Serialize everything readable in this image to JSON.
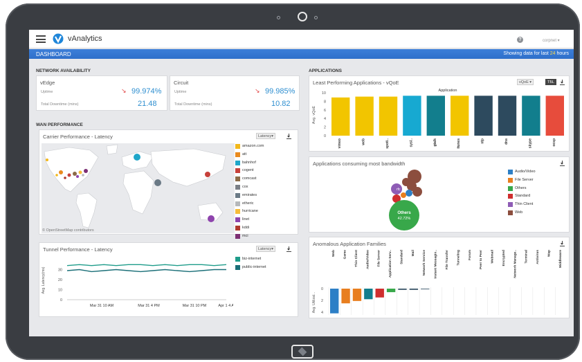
{
  "app": {
    "brand": "vAnalytics",
    "user": "corpnet ▾",
    "help": "?"
  },
  "dashbar": {
    "title": "DASHBOARD",
    "range_prefix": "Showing data for last",
    "range_value": "24",
    "range_unit": "hours"
  },
  "network": {
    "title": "NETWORK AVAILABILITY",
    "vedge": {
      "title": "vEdge",
      "uptime_label": "Uptime",
      "uptime": "99.974%",
      "downtime_label": "Total Downtime (mins)",
      "downtime": "21.48"
    },
    "circuit": {
      "title": "Circuit",
      "uptime_label": "Uptime",
      "uptime": "99.985%",
      "downtime_label": "Total Downtime (mins)",
      "downtime": "10.82"
    }
  },
  "wan": {
    "title": "WAN PERFORMANCE",
    "carrier": {
      "title": "Carrier Performance - Latency",
      "dropdown": "Latency▾",
      "credit": "© OpenStreetMap contributors",
      "legend": [
        {
          "name": "amazon.com",
          "color": "#f2b81b"
        },
        {
          "name": "att",
          "color": "#e98a1e"
        },
        {
          "name": "bahnhof",
          "color": "#1fa6c9"
        },
        {
          "name": "cogent",
          "color": "#c7413b"
        },
        {
          "name": "comcast",
          "color": "#8b6b47"
        },
        {
          "name": "cox",
          "color": "#7a7f86"
        },
        {
          "name": "emirates",
          "color": "#6b7a86"
        },
        {
          "name": "etheric",
          "color": "#b6b8bb"
        },
        {
          "name": "hurricane",
          "color": "#f6bc3a"
        },
        {
          "name": "linet",
          "color": "#8e44ad"
        },
        {
          "name": "kddi",
          "color": "#b03a2e"
        },
        {
          "name": "mci",
          "color": "#7d2f73"
        }
      ]
    },
    "tunnel": {
      "title": "Tunnel Performance - Latency",
      "dropdown": "Latency▾",
      "ylabel": "Avg. Latency(ms)",
      "legend": [
        {
          "name": "biz-internet",
          "color": "#1e9c8a"
        },
        {
          "name": "public-internet",
          "color": "#1b6f78"
        }
      ]
    }
  },
  "apps": {
    "title": "APPLICATIONS",
    "least": {
      "title": "Least Performing Applications - vQoE",
      "dropdown": "vQoE ▾",
      "toggle": "ТБL",
      "legend_title": "Application"
    },
    "bandwidth": {
      "title": "Applications consuming most bandwidth",
      "bubble_label": "Others",
      "bubble_value": "42.72%",
      "bubble_small": "rfc",
      "legend": [
        {
          "name": "Audio/Video",
          "color": "#2d7fc6"
        },
        {
          "name": "File Server",
          "color": "#e87e1f"
        },
        {
          "name": "Others",
          "color": "#38a84a"
        },
        {
          "name": "Standard",
          "color": "#cf2e2e"
        },
        {
          "name": "Thin Client",
          "color": "#8e5cb5"
        },
        {
          "name": "Web",
          "color": "#8c4e3e"
        }
      ]
    },
    "anomalous": {
      "title": "Anomalous Application Families",
      "ylabel": "Avg. Utilizat..."
    }
  },
  "chart_data": [
    {
      "type": "bar",
      "title": "Least Performing Applications - vQoE",
      "xlabel": "",
      "ylabel": "Avg. vQoE",
      "ylim": [
        0,
        10
      ],
      "yticks": [
        0,
        2,
        4,
        6,
        8,
        10
      ],
      "categories": [
        "vimeo",
        "web",
        "spoti..",
        "sysl..",
        "gtalk",
        "itunes",
        "ntp",
        "dns",
        "skype",
        "ocsp"
      ],
      "values": [
        8.9,
        9.1,
        9.1,
        9.3,
        9.3,
        9.3,
        9.3,
        9.3,
        9.3,
        9.3
      ],
      "colors": [
        "#f2c500",
        "#f2c500",
        "#f2c500",
        "#17a9d1",
        "#127e8d",
        "#f2c500",
        "#2d4a5e",
        "#2d4a5e",
        "#127e8d",
        "#e74c3c"
      ]
    },
    {
      "type": "line",
      "title": "Tunnel Performance - Latency",
      "ylabel": "Avg. Latency(ms)",
      "ylim": [
        0,
        40
      ],
      "yticks": [
        0,
        10,
        20,
        30
      ],
      "x": [
        "Mar 31 10 AM",
        "Mar 31 4 PM",
        "Mar 31 10 PM",
        "Apr 1 4 AM"
      ],
      "series": [
        {
          "name": "biz-internet",
          "values": [
            34,
            35,
            34,
            35,
            34,
            35,
            35,
            34,
            35,
            34,
            35,
            35,
            34,
            35
          ]
        },
        {
          "name": "public-internet",
          "values": [
            29,
            30,
            28,
            29,
            30,
            29,
            28,
            29,
            30,
            29,
            28,
            29,
            30,
            30
          ]
        }
      ]
    },
    {
      "type": "bar",
      "title": "Anomalous Application Families",
      "ylabel": "Avg. Utilizat...",
      "ylim": [
        4,
        0
      ],
      "yticks": [
        0,
        2,
        4
      ],
      "categories": [
        "Web",
        "Game",
        "Thin Client",
        "Audio/Video",
        "File Server",
        "Application Serv..",
        "Standard",
        "Mail",
        "Network Service",
        "Instant Messagin..",
        "File Transfer",
        "Tunneling",
        "Forum",
        "Peer to Peer",
        "Webmail",
        "Encrypted",
        "Network Manage..",
        "Terminal",
        "Antivirus",
        "Wap",
        "Middleware"
      ],
      "values": [
        4.2,
        2.5,
        2.1,
        1.8,
        1.5,
        0.6,
        0.2,
        0.2,
        0.1,
        0,
        0,
        0,
        0,
        0,
        0,
        0,
        0,
        0,
        0,
        0,
        0
      ],
      "colors": [
        "#2d7fc6",
        "#e87e1f",
        "#e87e1f",
        "#127e8d",
        "#cf2e2e",
        "#38a84a",
        "#2d4a5e",
        "#2d4a5e",
        "#2d4a5e",
        "#ccc",
        "#ccc",
        "#ccc",
        "#ccc",
        "#ccc",
        "#ccc",
        "#ccc",
        "#ccc",
        "#ccc",
        "#ccc",
        "#ccc",
        "#ccc"
      ]
    }
  ]
}
